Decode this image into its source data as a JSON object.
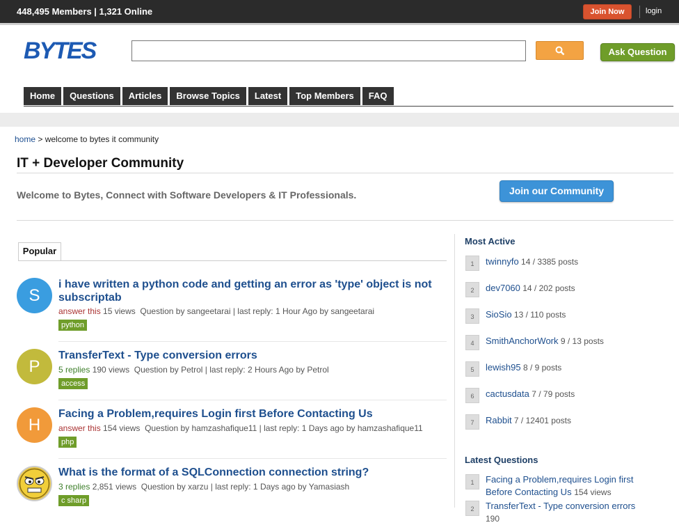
{
  "topbar": {
    "stats": "448,495 Members | 1,321 Online",
    "join_label": "Join Now",
    "login_label": "login"
  },
  "header": {
    "logo_text": "BYTES",
    "search_placeholder": "",
    "ask_label": "Ask Question"
  },
  "nav": {
    "items": [
      "Home",
      "Questions",
      "Articles",
      "Browse Topics",
      "Latest",
      "Top Members",
      "FAQ"
    ]
  },
  "breadcrumb": {
    "home": "home",
    "current": "> welcome to bytes it community"
  },
  "page": {
    "title": "IT + Developer Community",
    "welcome": "Welcome to Bytes, Connect with Software Developers & IT Professionals.",
    "join_community_label": "Join our Community",
    "tab_label": "Popular"
  },
  "questions": [
    {
      "avatar_letter": "S",
      "avatar_color": "#3a9de0",
      "title": "i have written a python code and getting an error as 'type' object is not subscriptab",
      "status": "answer this",
      "views": "15 views",
      "info": "Question by sangeetarai | last reply: 1 Hour Ago by sangeetarai",
      "tag": "python"
    },
    {
      "avatar_letter": "P",
      "avatar_color": "#c2ba3c",
      "title": "TransferText - Type conversion errors",
      "status": "5 replies",
      "views": "190 views",
      "info": "Question by Petrol | last reply: 2 Hours Ago by Petrol",
      "tag": "access"
    },
    {
      "avatar_letter": "H",
      "avatar_color": "#f19a3a",
      "title": "Facing a Problem,requires Login first Before Contacting Us",
      "status": "answer this",
      "views": "154 views",
      "info": "Question by hamzashafique11 | last reply: 1 Days ago by hamzashafique11",
      "tag": "php"
    },
    {
      "avatar_letter": "",
      "avatar_color": "#e8c64a",
      "title": "What is the format of a SQLConnection connection string?",
      "status": "3 replies",
      "views": "2,851 views",
      "info": "Question by xarzu | last reply: 1 Days ago by Yamasiash",
      "tag": "c sharp"
    }
  ],
  "sidebar": {
    "most_active_title": "Most Active",
    "members": [
      {
        "rank": "1",
        "name": "twinnyfo",
        "stats": "14 / 3385 posts"
      },
      {
        "rank": "2",
        "name": "dev7060",
        "stats": "14 / 202 posts"
      },
      {
        "rank": "3",
        "name": "SioSio",
        "stats": "13 / 110 posts"
      },
      {
        "rank": "4",
        "name": "SmithAnchorWork",
        "stats": "9 / 13 posts"
      },
      {
        "rank": "5",
        "name": "lewish95",
        "stats": "8 / 9 posts"
      },
      {
        "rank": "6",
        "name": "cactusdata",
        "stats": "7 / 79 posts"
      },
      {
        "rank": "7",
        "name": "Rabbit",
        "stats": "7 / 12401 posts"
      }
    ],
    "latest_title": "Latest Questions",
    "latest": [
      {
        "rank": "1",
        "title": "Facing a Problem,requires Login first Before Contacting Us",
        "views": "154 views"
      },
      {
        "rank": "2",
        "title": "TransferText - Type conversion errors",
        "views": "190"
      }
    ]
  }
}
